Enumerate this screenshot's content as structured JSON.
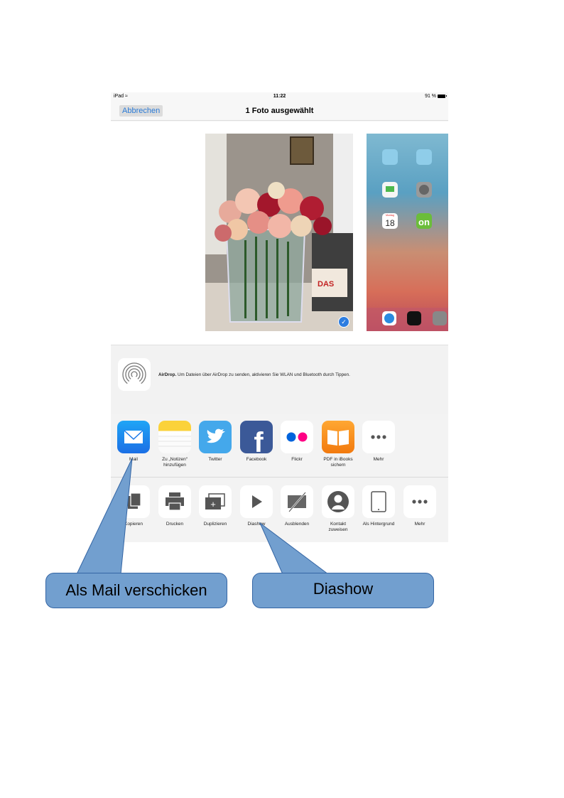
{
  "status": {
    "device": "iPad",
    "time": "11:22",
    "battery": "91 %"
  },
  "navbar": {
    "cancel_label": "Abbrechen",
    "title": "1 Foto ausgewählt"
  },
  "airdrop": {
    "title": "AirDrop.",
    "text": " Um Dateien über AirDrop zu senden, aktivieren Sie WLAN und Bluetooth durch Tippen."
  },
  "share_row": [
    {
      "label": "Mail",
      "icon": "mail-icon"
    },
    {
      "label": "Zu „Notizen“\nhinzufügen",
      "icon": "notes-icon"
    },
    {
      "label": "Twitter",
      "icon": "twitter-icon"
    },
    {
      "label": "Facebook",
      "icon": "facebook-icon"
    },
    {
      "label": "Flickr",
      "icon": "flickr-icon"
    },
    {
      "label": "PDF in iBooks\nsichern",
      "icon": "ibooks-icon"
    },
    {
      "label": "Mehr",
      "icon": "more-icon"
    }
  ],
  "action_row": [
    {
      "label": "Kopieren",
      "icon": "copy-icon"
    },
    {
      "label": "Drucken",
      "icon": "print-icon"
    },
    {
      "label": "Duplizieren",
      "icon": "duplicate-icon"
    },
    {
      "label": "Diashow",
      "icon": "play-icon"
    },
    {
      "label": "Ausblenden",
      "icon": "hide-icon"
    },
    {
      "label": "Kontakt\nzuweisen",
      "icon": "contact-icon"
    },
    {
      "label": "Als Hintergrund",
      "icon": "wallpaper-icon"
    },
    {
      "label": "Mehr",
      "icon": "more-icon"
    }
  ],
  "home_screen": {
    "calendar_weekday": "Montag",
    "calendar_day": "18"
  },
  "callouts": {
    "mail": "Als Mail verschicken",
    "diashow": "Diashow"
  },
  "colors": {
    "accent": "#2a7ad6",
    "callout_fill": "#729fcf",
    "callout_border": "#3465a4"
  }
}
